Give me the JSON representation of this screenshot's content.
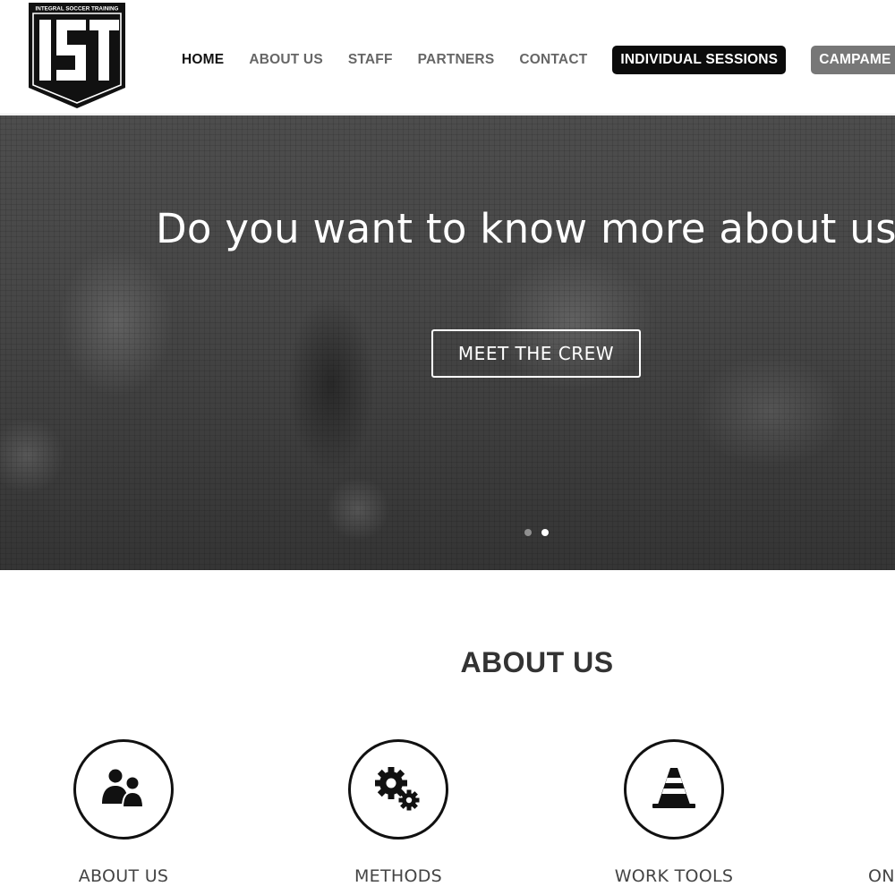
{
  "logo": {
    "text": "INTEGRAL SOCCER TRAINING",
    "mark": "IST"
  },
  "nav": {
    "items": [
      {
        "label": "HOME",
        "active": true
      },
      {
        "label": "ABOUT US"
      },
      {
        "label": "STAFF"
      },
      {
        "label": "PARTNERS"
      },
      {
        "label": "CONTACT"
      }
    ],
    "individual_sessions": "INDIVIDUAL SESSIONS",
    "campaments": "CAMPAME"
  },
  "hero": {
    "title": "Do you want to know more about us?",
    "button": "MEET THE CREW",
    "slide_count": 2,
    "active_slide": 2
  },
  "about": {
    "title": "ABOUT US",
    "features": [
      {
        "label": "ABOUT US",
        "icon": "users-icon"
      },
      {
        "label": "METHODS",
        "icon": "gears-icon"
      },
      {
        "label": "WORK TOOLS",
        "icon": "cone-icon"
      },
      {
        "label": "ON",
        "icon": ""
      }
    ]
  },
  "colors": {
    "pill_dark": "#0b0b0b",
    "pill_grey": "#777777",
    "nav_text": "#666666",
    "nav_active": "#111111"
  }
}
